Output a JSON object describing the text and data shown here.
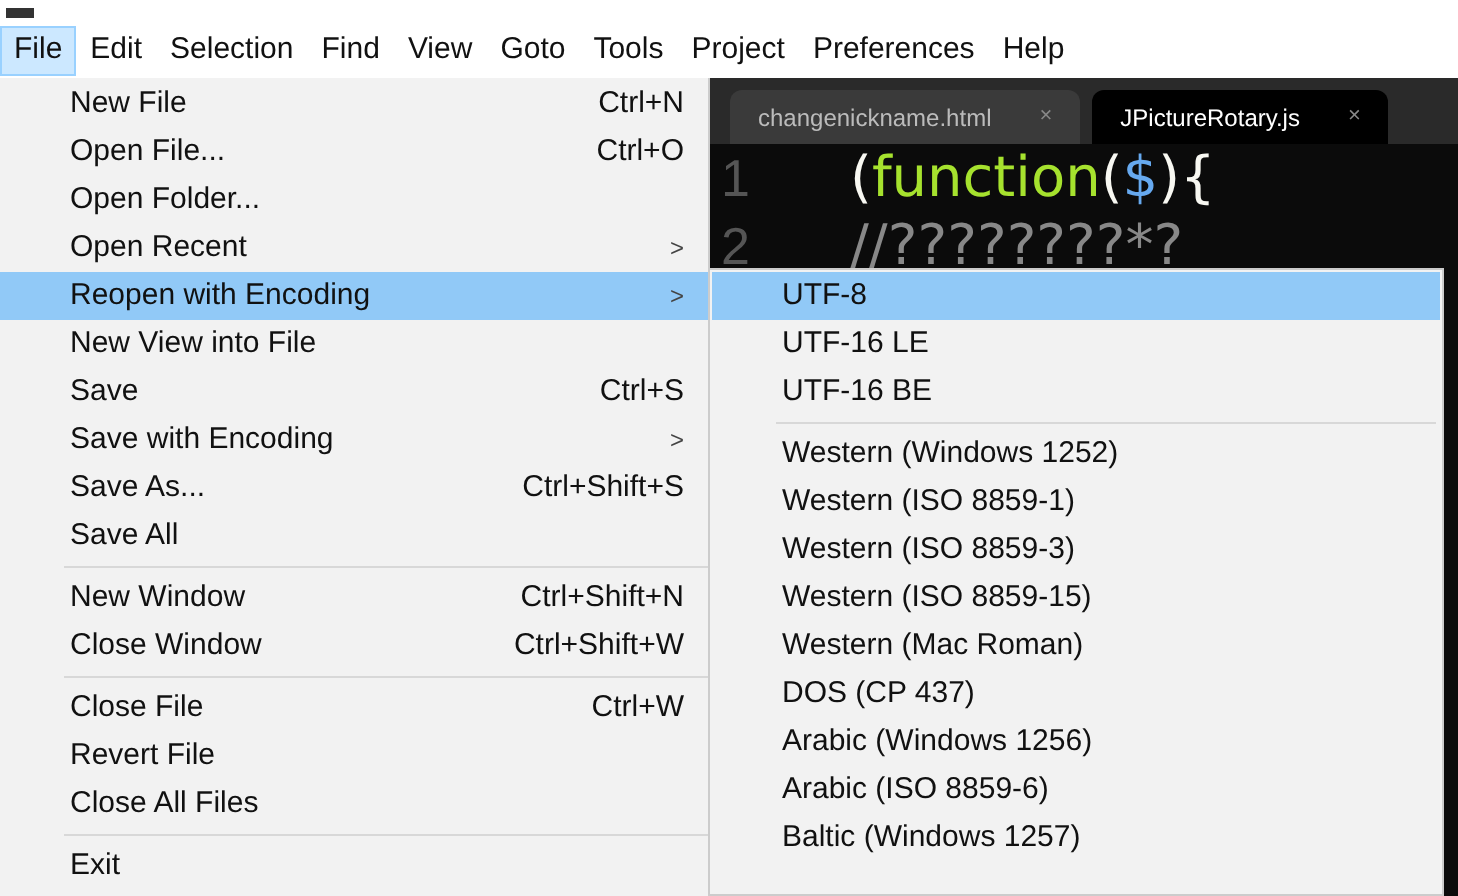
{
  "menubar": [
    {
      "label": "File",
      "selected": true
    },
    {
      "label": "Edit",
      "selected": false
    },
    {
      "label": "Selection",
      "selected": false
    },
    {
      "label": "Find",
      "selected": false
    },
    {
      "label": "View",
      "selected": false
    },
    {
      "label": "Goto",
      "selected": false
    },
    {
      "label": "Tools",
      "selected": false
    },
    {
      "label": "Project",
      "selected": false
    },
    {
      "label": "Preferences",
      "selected": false
    },
    {
      "label": "Help",
      "selected": false
    }
  ],
  "tabs": [
    {
      "label": "changenickname.html",
      "close": "×",
      "selected": false
    },
    {
      "label": "JPictureRotary.js",
      "close": "×",
      "selected": true
    }
  ],
  "editor": {
    "line_numbers": [
      "1",
      "2"
    ],
    "lines": [
      {
        "open": "(",
        "keyword": "function",
        "paren": "(",
        "arg": "$",
        "close": "){"
      },
      {
        "text": "//????????*?"
      }
    ]
  },
  "file_menu": [
    {
      "kind": "item",
      "label": "New File",
      "shortcut": "Ctrl+N",
      "selected": false
    },
    {
      "kind": "item",
      "label": "Open File...",
      "shortcut": "Ctrl+O",
      "selected": false
    },
    {
      "kind": "item",
      "label": "Open Folder...",
      "selected": false
    },
    {
      "kind": "submenu",
      "label": "Open Recent",
      "arrow": ">",
      "selected": false
    },
    {
      "kind": "submenu",
      "label": "Reopen with Encoding",
      "arrow": ">",
      "selected": true
    },
    {
      "kind": "item",
      "label": "New View into File",
      "selected": false
    },
    {
      "kind": "item",
      "label": "Save",
      "shortcut": "Ctrl+S",
      "selected": false
    },
    {
      "kind": "submenu",
      "label": "Save with Encoding",
      "arrow": ">",
      "selected": false
    },
    {
      "kind": "item",
      "label": "Save As...",
      "shortcut": "Ctrl+Shift+S",
      "selected": false
    },
    {
      "kind": "item",
      "label": "Save All",
      "selected": false
    },
    {
      "kind": "separator"
    },
    {
      "kind": "item",
      "label": "New Window",
      "shortcut": "Ctrl+Shift+N",
      "selected": false
    },
    {
      "kind": "item",
      "label": "Close Window",
      "shortcut": "Ctrl+Shift+W",
      "selected": false
    },
    {
      "kind": "separator"
    },
    {
      "kind": "item",
      "label": "Close File",
      "shortcut": "Ctrl+W",
      "selected": false
    },
    {
      "kind": "item",
      "label": "Revert File",
      "selected": false
    },
    {
      "kind": "item",
      "label": "Close All Files",
      "selected": false
    },
    {
      "kind": "separator"
    },
    {
      "kind": "item",
      "label": "Exit",
      "selected": false
    }
  ],
  "encoding_menu": [
    {
      "kind": "item",
      "label": "UTF-8",
      "selected": true
    },
    {
      "kind": "item",
      "label": "UTF-16 LE",
      "selected": false
    },
    {
      "kind": "item",
      "label": "UTF-16 BE",
      "selected": false
    },
    {
      "kind": "separator"
    },
    {
      "kind": "item",
      "label": "Western (Windows 1252)",
      "selected": false
    },
    {
      "kind": "item",
      "label": "Western (ISO 8859-1)",
      "selected": false
    },
    {
      "kind": "item",
      "label": "Western (ISO 8859-3)",
      "selected": false
    },
    {
      "kind": "item",
      "label": "Western (ISO 8859-15)",
      "selected": false
    },
    {
      "kind": "item",
      "label": "Western (Mac Roman)",
      "selected": false
    },
    {
      "kind": "item",
      "label": "DOS (CP 437)",
      "selected": false
    },
    {
      "kind": "item",
      "label": "Arabic (Windows 1256)",
      "selected": false
    },
    {
      "kind": "item",
      "label": "Arabic (ISO 8859-6)",
      "selected": false
    },
    {
      "kind": "item",
      "label": "Baltic (Windows 1257)",
      "selected": false
    }
  ]
}
